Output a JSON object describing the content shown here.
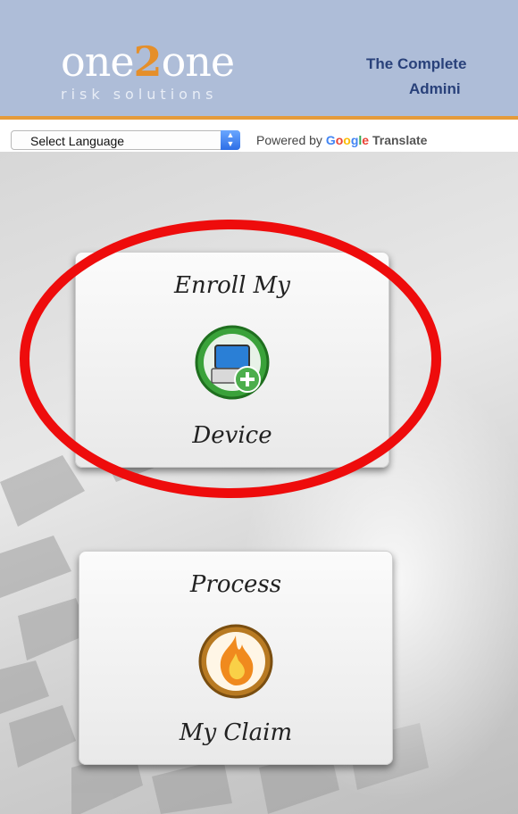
{
  "header": {
    "logo_main_a": "one",
    "logo_main_b": "2",
    "logo_main_c": "one",
    "logo_sub": "risk solutions",
    "tagline_line1": "The Complete",
    "tagline_line2": "Admini"
  },
  "translate": {
    "select_value": "Select Language",
    "powered_by": "Powered by",
    "google": "Google",
    "translate": "Translate"
  },
  "cards": {
    "enroll": {
      "top": "Enroll My",
      "bottom": "Device"
    },
    "claim": {
      "top": "Process",
      "bottom": "My Claim"
    }
  },
  "colors": {
    "header_bg": "#aebdd8",
    "accent_orange": "#e58f2a",
    "tagline": "#29417a",
    "highlight_red": "#ee0c0c"
  },
  "icons": [
    "device-plus-icon",
    "fire-claim-icon",
    "select-arrow-icon"
  ]
}
